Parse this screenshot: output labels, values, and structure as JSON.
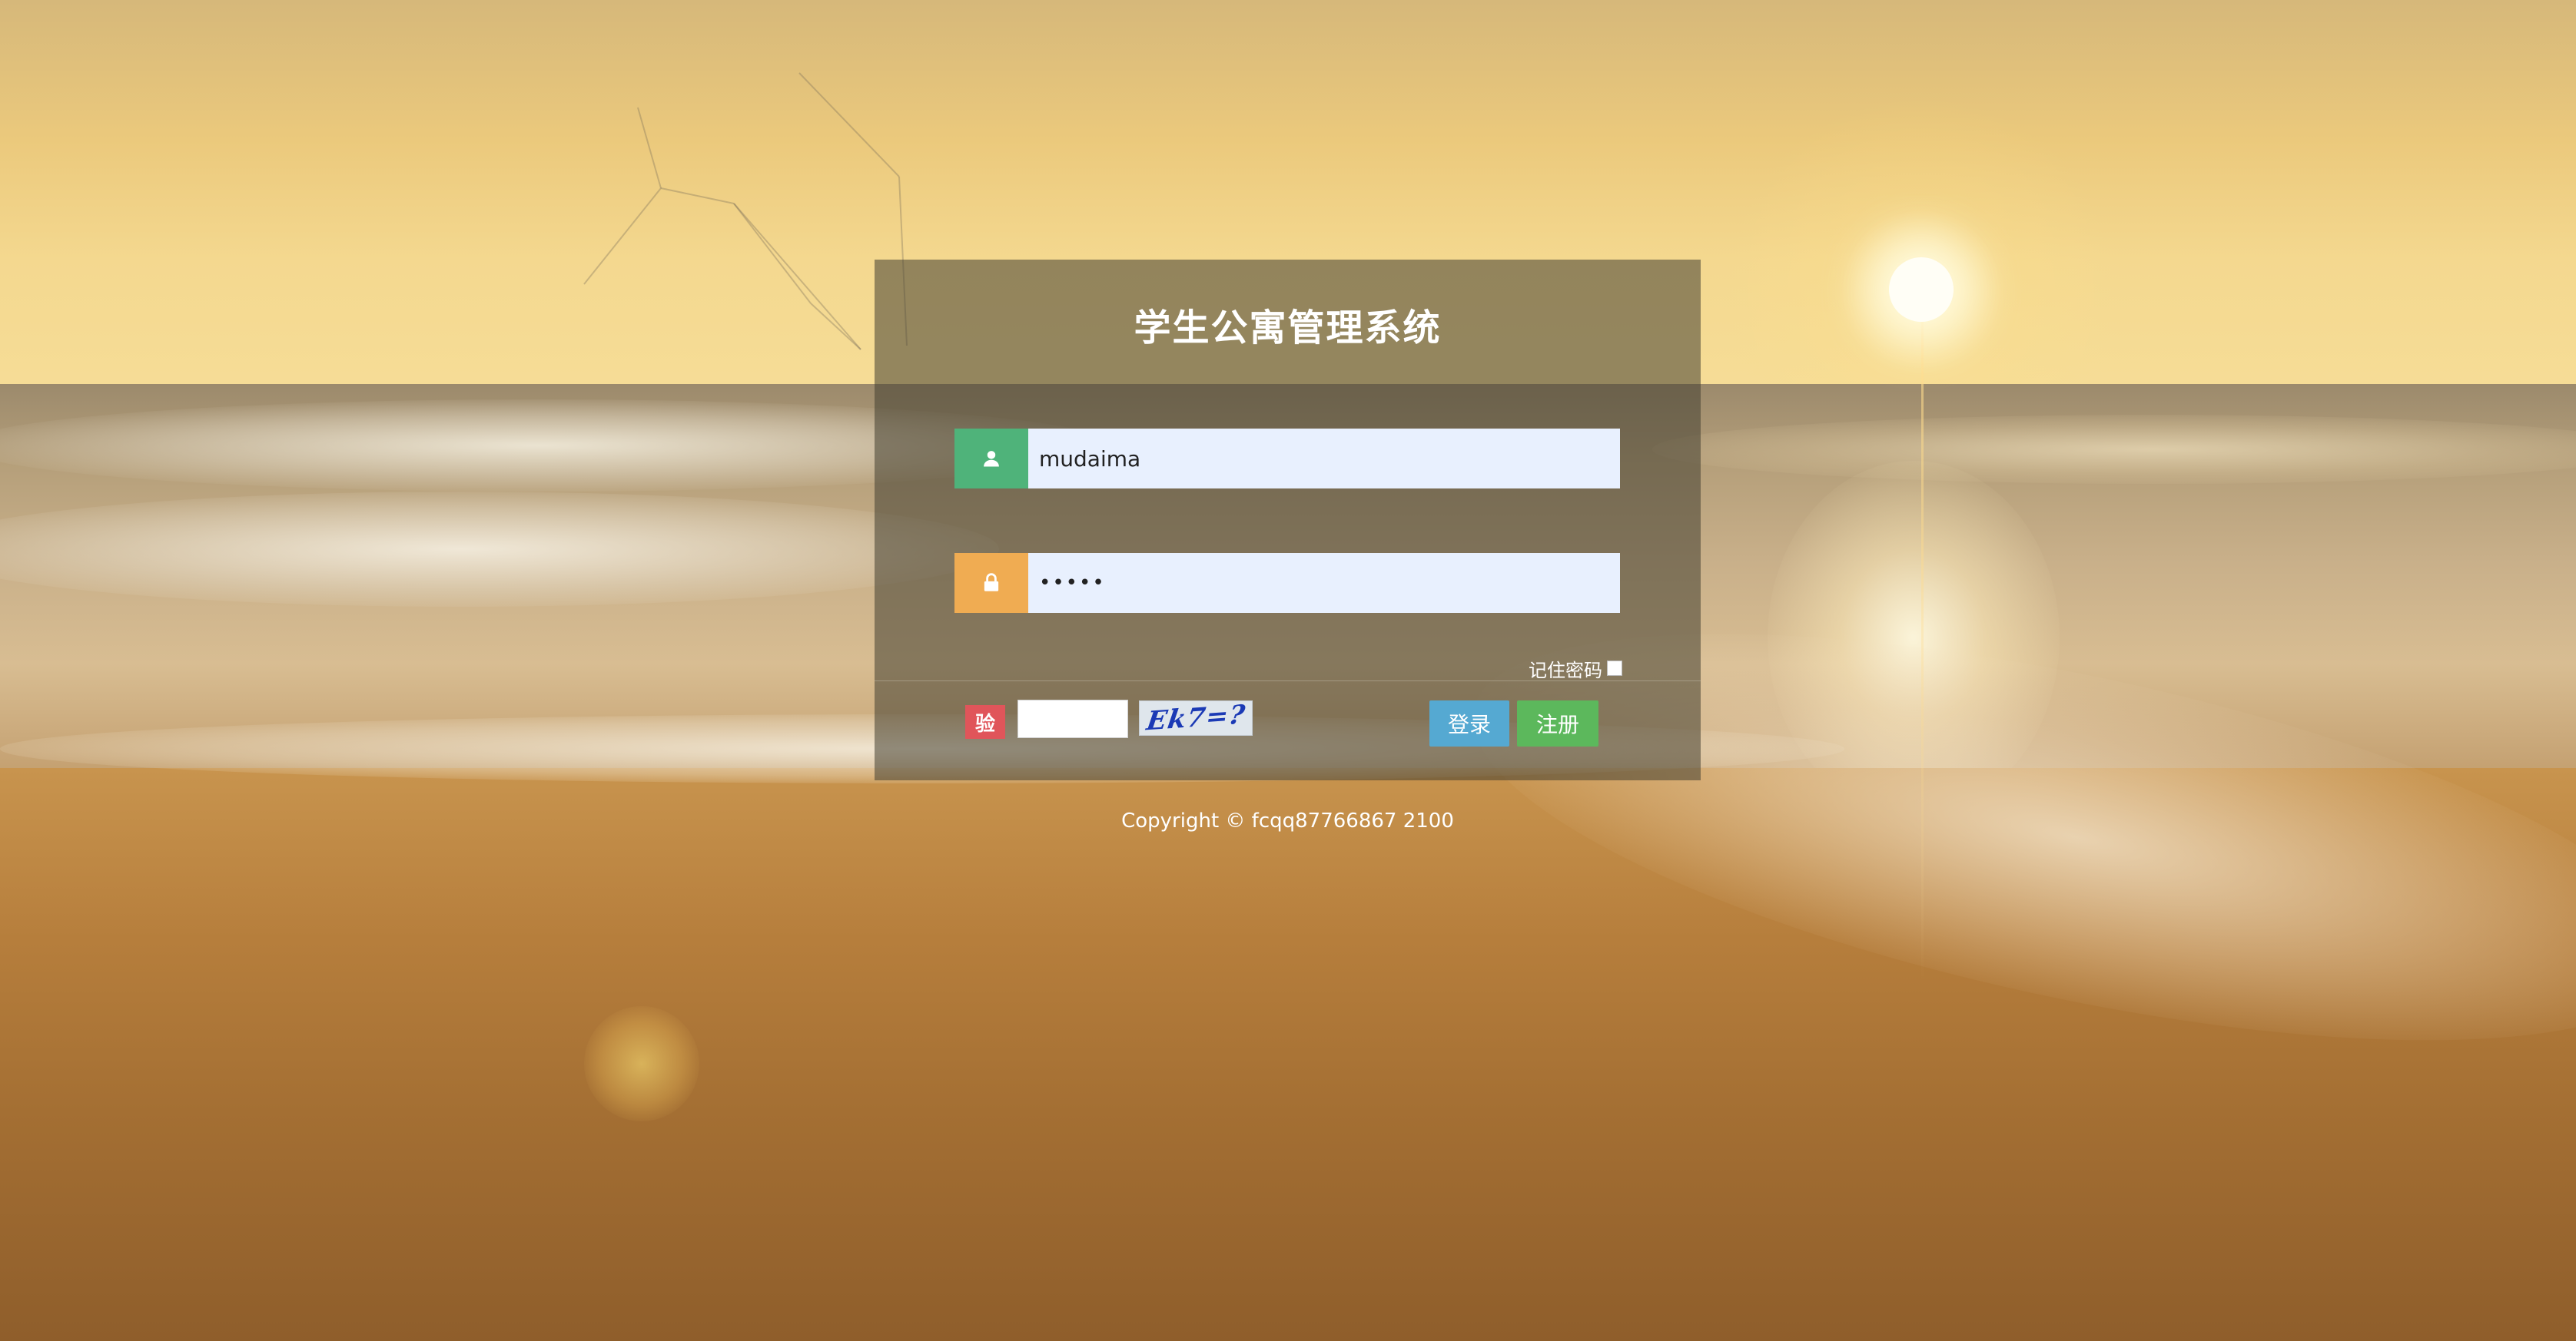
{
  "login": {
    "title": "学生公寓管理系统",
    "username": {
      "value": "mudaima",
      "icon": "user-icon"
    },
    "password": {
      "value": "•••••",
      "icon": "lock-icon"
    },
    "remember_label": "记住密码",
    "remember_checked": false,
    "captcha": {
      "tag": "验",
      "input_value": "",
      "image_text": "Ek7=?"
    },
    "login_button": "登录",
    "register_button": "注册"
  },
  "footer": {
    "copyright": "Copyright © fcqq87766867 2100"
  },
  "colors": {
    "panel_bg": "rgba(68,64,50,0.55)",
    "user_addon": "#4fb37a",
    "password_addon": "#f0ac52",
    "captcha_tag": "#e0555a",
    "login_button": "#55a9d2",
    "register_button": "#5cb85c",
    "input_bg": "#e8f0fe"
  }
}
